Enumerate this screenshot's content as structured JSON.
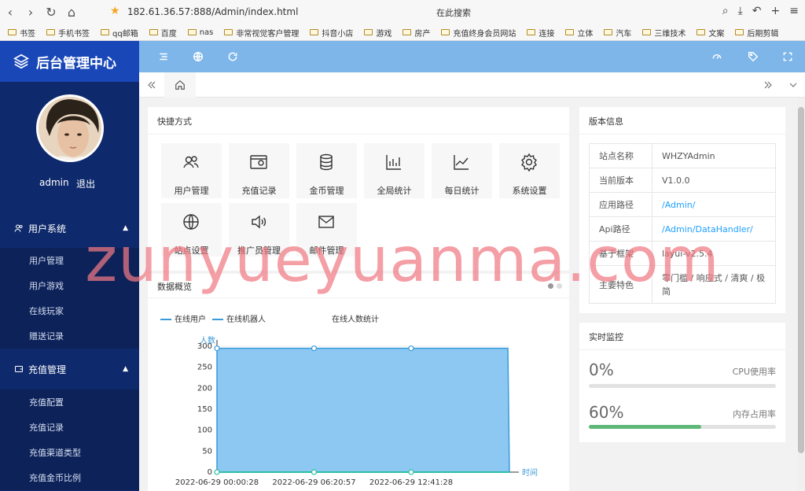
{
  "browser": {
    "url": "182.61.36.57:888/Admin/index.html",
    "search_placeholder": "在此搜索",
    "bookmarks": [
      "书签",
      "手机书签",
      "qq邮箱",
      "百度",
      "nas",
      "非常视觉客户管理",
      "抖音小店",
      "游戏",
      "房产",
      "充值终身会员网站",
      "连接",
      "立体",
      "汽车",
      "三维技术",
      "文案",
      "后期剪辑"
    ]
  },
  "sidebar": {
    "app_title": "后台管理中心",
    "user_name": "admin",
    "logout_label": "退出",
    "groups": [
      {
        "label": "用户系统",
        "items": [
          "用户管理",
          "用户游戏",
          "在线玩家",
          "赠送记录"
        ]
      },
      {
        "label": "充值管理",
        "items": [
          "充值配置",
          "充值记录",
          "充值渠道类型",
          "充值金币比例"
        ]
      }
    ]
  },
  "shortcuts": {
    "title": "快捷方式",
    "items": [
      {
        "label": "用户管理",
        "icon": "users-icon"
      },
      {
        "label": "充值记录",
        "icon": "wallet-icon"
      },
      {
        "label": "金币管理",
        "icon": "database-icon"
      },
      {
        "label": "全局统计",
        "icon": "bar-chart-icon"
      },
      {
        "label": "每日统计",
        "icon": "line-chart-icon"
      },
      {
        "label": "系统设置",
        "icon": "gear-icon"
      },
      {
        "label": "站点设置",
        "icon": "globe-icon"
      },
      {
        "label": "推广员管理",
        "icon": "speaker-icon"
      },
      {
        "label": "邮件管理",
        "icon": "mail-icon"
      }
    ]
  },
  "overview": {
    "title": "数据概览"
  },
  "version": {
    "title": "版本信息",
    "rows": [
      {
        "key": "站点名称",
        "value": "WHZYAdmin"
      },
      {
        "key": "当前版本",
        "value": "V1.0.0"
      },
      {
        "key": "应用路径",
        "value": "/Admin/"
      },
      {
        "key": "Api路径",
        "value": "/Admin/DataHandler/"
      },
      {
        "key": "基于框架",
        "value": "layui-v2.5.4"
      },
      {
        "key": "主要特色",
        "value": "零门槛 / 响应式 / 清爽 / 极简"
      }
    ]
  },
  "monitor": {
    "title": "实时监控",
    "cpu": {
      "value": "0%",
      "label": "CPU使用率",
      "percent": 0
    },
    "mem": {
      "value": "60%",
      "label": "内存占用率",
      "percent": 60
    }
  },
  "chart_data": {
    "type": "area",
    "title": "在线人数统计",
    "legend": [
      "在线用户",
      "在线机器人"
    ],
    "ylabel": "人数",
    "xlabel": "时间",
    "ylim": [
      0,
      300
    ],
    "yticks": [
      0,
      50,
      100,
      150,
      200,
      250,
      300
    ],
    "x_tick_labels": [
      "2022-06-29 00:00:28",
      "2022-06-29 06:20:57",
      "2022-06-29 12:41:28"
    ],
    "x": [
      0,
      6.34,
      12.68,
      19.0,
      19.1
    ],
    "series": [
      {
        "name": "在线用户",
        "values": [
          295,
          295,
          295,
          295,
          0
        ]
      },
      {
        "name": "在线机器人",
        "values": [
          0,
          0,
          0,
          0,
          0
        ]
      }
    ]
  },
  "watermark": "zunyueyuanma.com"
}
